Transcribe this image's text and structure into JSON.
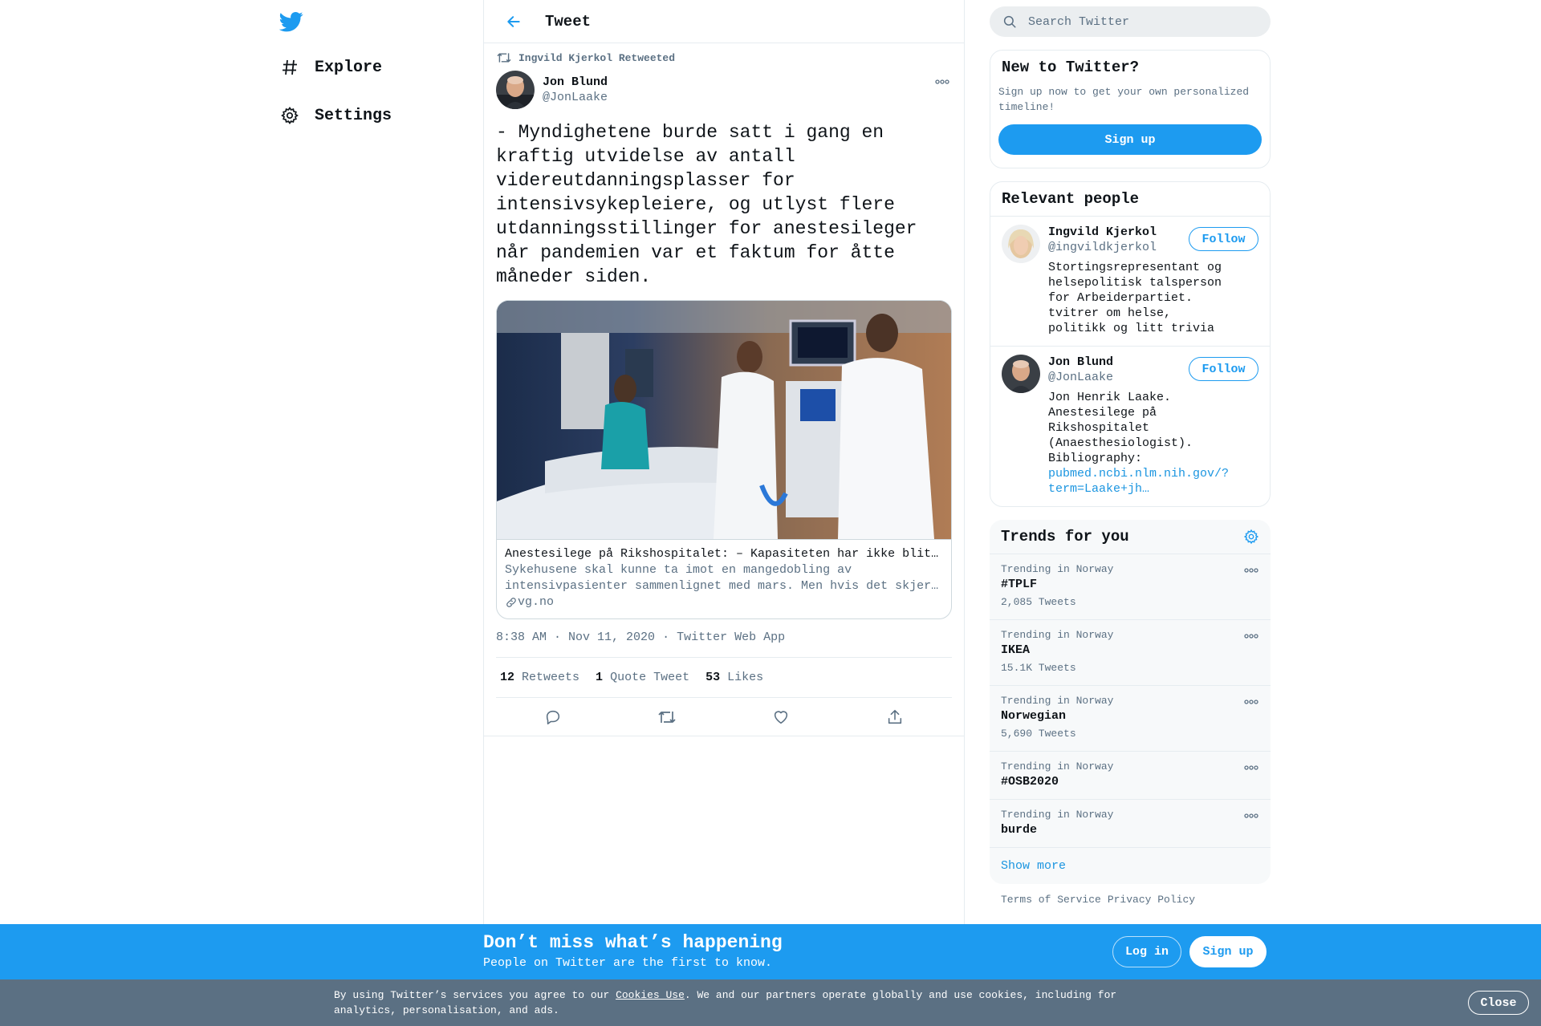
{
  "nav": {
    "logo": "twitter-bird-icon",
    "items": [
      {
        "label": "Explore",
        "icon": "hashtag-icon"
      },
      {
        "label": "Settings",
        "icon": "gear-icon"
      }
    ]
  },
  "header": {
    "title": "Tweet"
  },
  "tweet": {
    "retweeted_by": "Ingvild Kjerkol Retweeted",
    "author_name": "Jon Blund",
    "author_handle": "@JonLaake",
    "text": "- Myndighetene burde satt i gang en kraftig utvidelse av antall videreutdanningsplasser for intensivsykepleiere, og utlyst flere utdanningsstillinger for anestesileger når pandemien var et faktum for åtte måneder siden.",
    "card": {
      "title": "Anestesilege på Rikshospitalet: – Kapasiteten har ikke blitt bygget ut",
      "description": "Sykehusene skal kunne ta imot en mangedobling av intensivpasienter sammenlignet med mars. Men hvis det skjer, kommer det til å gå ut over pasientene.",
      "domain": "vg.no"
    },
    "timestamp": "8:38 AM · Nov 11, 2020",
    "source": "Twitter Web App",
    "stats": {
      "retweets_count": "12",
      "retweets_label": "Retweets",
      "quotes_count": "1",
      "quotes_label": "Quote Tweet",
      "likes_count": "53",
      "likes_label": "Likes"
    }
  },
  "search": {
    "placeholder": "Search Twitter"
  },
  "new_to_twitter": {
    "title": "New to Twitter?",
    "subtitle": "Sign up now to get your own personalized timeline!",
    "button": "Sign up"
  },
  "relevant_people": {
    "title": "Relevant people",
    "people": [
      {
        "name": "Ingvild Kjerkol",
        "handle": "@ingvildkjerkol",
        "bio": "Stortingsrepresentant og helsepolitisk talsperson for Arbeiderpartiet. tvitrer om helse, politikk og litt trivia",
        "follow": "Follow"
      },
      {
        "name": "Jon Blund",
        "handle": "@JonLaake",
        "bio": "Jon Henrik Laake. Anestesilege på Rikshospitalet (Anaesthesiologist). Bibliography:",
        "link": "pubmed.ncbi.nlm.nih.gov/?term=Laake+jh…",
        "follow": "Follow"
      }
    ]
  },
  "trends": {
    "title": "Trends for you",
    "items": [
      {
        "meta": "Trending in Norway",
        "name": "#TPLF",
        "count": "2,085 Tweets"
      },
      {
        "meta": "Trending in Norway",
        "name": "IKEA",
        "count": "15.1K Tweets"
      },
      {
        "meta": "Trending in Norway",
        "name": "Norwegian",
        "count": "5,690 Tweets"
      },
      {
        "meta": "Trending in Norway",
        "name": "#OSB2020",
        "count": ""
      },
      {
        "meta": "Trending in Norway",
        "name": "burde",
        "count": ""
      }
    ],
    "show_more": "Show more"
  },
  "footer": {
    "terms": "Terms of Service",
    "privacy": "Privacy Policy"
  },
  "signup_bar": {
    "title": "Don’t miss what’s happening",
    "subtitle": "People on Twitter are the first to know.",
    "login": "Log in",
    "signup": "Sign up"
  },
  "cookie": {
    "text_before": "By using Twitter’s services you agree to our ",
    "link": "Cookies Use",
    "text_after": ". We and our partners operate globally and use cookies, including for analytics, personalisation, and ads.",
    "close": "Close"
  },
  "colors": {
    "accent": "#1d9bf0",
    "secondary_text": "#5b7083",
    "cookie_bg": "#5b7083"
  }
}
